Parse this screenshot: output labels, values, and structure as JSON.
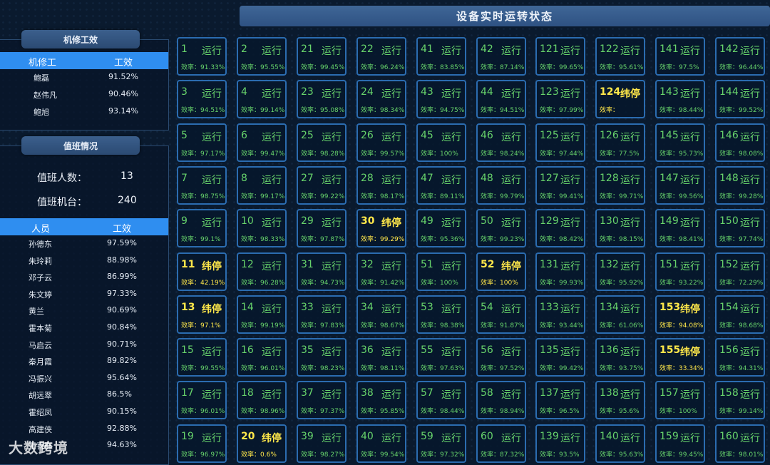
{
  "mechanic_panel": {
    "title": "机修工效",
    "headers": [
      "机修工",
      "工效"
    ],
    "rows": [
      {
        "name": "鲍磊",
        "eff": "91.52%"
      },
      {
        "name": "赵伟凡",
        "eff": "90.46%"
      },
      {
        "name": "鲍旭",
        "eff": "93.14%"
      }
    ]
  },
  "duty_panel": {
    "title": "值班情况",
    "count_label": "值班人数：",
    "count_value": "13",
    "machines_label": "值班机台：",
    "machines_value": "240",
    "headers": [
      "人员",
      "工效"
    ],
    "rows": [
      {
        "name": "孙德东",
        "eff": "97.59%"
      },
      {
        "name": "朱玲莉",
        "eff": "88.98%"
      },
      {
        "name": "邓子云",
        "eff": "86.99%"
      },
      {
        "name": "朱文婷",
        "eff": "97.33%"
      },
      {
        "name": "黄兰",
        "eff": "90.69%"
      },
      {
        "name": "霍本菊",
        "eff": "90.84%"
      },
      {
        "name": "马启云",
        "eff": "90.71%"
      },
      {
        "name": "秦月霞",
        "eff": "89.82%"
      },
      {
        "name": "冯振兴",
        "eff": "95.64%"
      },
      {
        "name": "胡远翠",
        "eff": "86.5%"
      },
      {
        "name": "霍绍凤",
        "eff": "90.15%"
      },
      {
        "name": "高建侠",
        "eff": "92.88%"
      },
      {
        "name": "王喜群",
        "eff": "94.63%"
      }
    ]
  },
  "status_panel": {
    "title": "设备实时运转状态",
    "running_label": "运行",
    "stopped_label": "纬停",
    "eff_prefix": "效率：",
    "columns": [
      [
        {
          "id": "1",
          "status": "运行",
          "eff": "91.33%"
        },
        {
          "id": "3",
          "status": "运行",
          "eff": "94.51%"
        },
        {
          "id": "5",
          "status": "运行",
          "eff": "97.17%"
        },
        {
          "id": "7",
          "status": "运行",
          "eff": "98.75%"
        },
        {
          "id": "9",
          "status": "运行",
          "eff": "99.1%"
        },
        {
          "id": "11",
          "status": "纬停",
          "eff": "42.19%"
        },
        {
          "id": "13",
          "status": "纬停",
          "eff": "97.1%"
        },
        {
          "id": "15",
          "status": "运行",
          "eff": "99.55%"
        },
        {
          "id": "17",
          "status": "运行",
          "eff": "96.01%"
        },
        {
          "id": "19",
          "status": "运行",
          "eff": "96.97%"
        }
      ],
      [
        {
          "id": "2",
          "status": "运行",
          "eff": "95.55%"
        },
        {
          "id": "4",
          "status": "运行",
          "eff": "99.14%"
        },
        {
          "id": "6",
          "status": "运行",
          "eff": "99.47%"
        },
        {
          "id": "8",
          "status": "运行",
          "eff": "99.17%"
        },
        {
          "id": "10",
          "status": "运行",
          "eff": "98.33%"
        },
        {
          "id": "12",
          "status": "运行",
          "eff": "96.28%"
        },
        {
          "id": "14",
          "status": "运行",
          "eff": "99.19%"
        },
        {
          "id": "16",
          "status": "运行",
          "eff": "96.01%"
        },
        {
          "id": "18",
          "status": "运行",
          "eff": "98.96%"
        },
        {
          "id": "20",
          "status": "纬停",
          "eff": "0.6%"
        }
      ],
      [
        {
          "id": "21",
          "status": "运行",
          "eff": "99.45%"
        },
        {
          "id": "23",
          "status": "运行",
          "eff": "95.08%"
        },
        {
          "id": "25",
          "status": "运行",
          "eff": "98.28%"
        },
        {
          "id": "27",
          "status": "运行",
          "eff": "99.22%"
        },
        {
          "id": "29",
          "status": "运行",
          "eff": "97.87%"
        },
        {
          "id": "31",
          "status": "运行",
          "eff": "94.73%"
        },
        {
          "id": "33",
          "status": "运行",
          "eff": "97.83%"
        },
        {
          "id": "35",
          "status": "运行",
          "eff": "98.23%"
        },
        {
          "id": "37",
          "status": "运行",
          "eff": "97.37%"
        },
        {
          "id": "39",
          "status": "运行",
          "eff": "98.27%"
        }
      ],
      [
        {
          "id": "22",
          "status": "运行",
          "eff": "96.24%"
        },
        {
          "id": "24",
          "status": "运行",
          "eff": "98.34%"
        },
        {
          "id": "26",
          "status": "运行",
          "eff": "99.57%"
        },
        {
          "id": "28",
          "status": "运行",
          "eff": "98.17%"
        },
        {
          "id": "30",
          "status": "纬停",
          "eff": "99.29%"
        },
        {
          "id": "32",
          "status": "运行",
          "eff": "91.42%"
        },
        {
          "id": "34",
          "status": "运行",
          "eff": "98.67%"
        },
        {
          "id": "36",
          "status": "运行",
          "eff": "98.11%"
        },
        {
          "id": "38",
          "status": "运行",
          "eff": "95.85%"
        },
        {
          "id": "40",
          "status": "运行",
          "eff": "99.54%"
        }
      ],
      [
        {
          "id": "41",
          "status": "运行",
          "eff": "83.85%"
        },
        {
          "id": "43",
          "status": "运行",
          "eff": "94.75%"
        },
        {
          "id": "45",
          "status": "运行",
          "eff": "100%"
        },
        {
          "id": "47",
          "status": "运行",
          "eff": "89.11%"
        },
        {
          "id": "49",
          "status": "运行",
          "eff": "95.36%"
        },
        {
          "id": "51",
          "status": "运行",
          "eff": "100%"
        },
        {
          "id": "53",
          "status": "运行",
          "eff": "98.38%"
        },
        {
          "id": "55",
          "status": "运行",
          "eff": "97.63%"
        },
        {
          "id": "57",
          "status": "运行",
          "eff": "98.44%"
        },
        {
          "id": "59",
          "status": "运行",
          "eff": "97.32%"
        }
      ],
      [
        {
          "id": "42",
          "status": "运行",
          "eff": "87.14%"
        },
        {
          "id": "44",
          "status": "运行",
          "eff": "94.51%"
        },
        {
          "id": "46",
          "status": "运行",
          "eff": "98.24%"
        },
        {
          "id": "48",
          "status": "运行",
          "eff": "99.79%"
        },
        {
          "id": "50",
          "status": "运行",
          "eff": "99.23%"
        },
        {
          "id": "52",
          "status": "纬停",
          "eff": "100%"
        },
        {
          "id": "54",
          "status": "运行",
          "eff": "91.87%"
        },
        {
          "id": "56",
          "status": "运行",
          "eff": "97.52%"
        },
        {
          "id": "58",
          "status": "运行",
          "eff": "98.94%"
        },
        {
          "id": "60",
          "status": "运行",
          "eff": "87.32%"
        }
      ],
      [
        {
          "id": "121",
          "status": "运行",
          "eff": "99.65%"
        },
        {
          "id": "123",
          "status": "运行",
          "eff": "97.99%"
        },
        {
          "id": "125",
          "status": "运行",
          "eff": "97.44%"
        },
        {
          "id": "127",
          "status": "运行",
          "eff": "99.41%"
        },
        {
          "id": "129",
          "status": "运行",
          "eff": "98.42%"
        },
        {
          "id": "131",
          "status": "运行",
          "eff": "99.93%"
        },
        {
          "id": "133",
          "status": "运行",
          "eff": "93.44%"
        },
        {
          "id": "135",
          "status": "运行",
          "eff": "99.42%"
        },
        {
          "id": "137",
          "status": "运行",
          "eff": "96.5%"
        },
        {
          "id": "139",
          "status": "运行",
          "eff": "93.5%"
        }
      ],
      [
        {
          "id": "122",
          "status": "运行",
          "eff": "95.61%"
        },
        {
          "id": "124",
          "status": "纬停",
          "eff": ""
        },
        {
          "id": "126",
          "status": "运行",
          "eff": "77.5%"
        },
        {
          "id": "128",
          "status": "运行",
          "eff": "99.71%"
        },
        {
          "id": "130",
          "status": "运行",
          "eff": "98.15%"
        },
        {
          "id": "132",
          "status": "运行",
          "eff": "95.92%"
        },
        {
          "id": "134",
          "status": "运行",
          "eff": "61.06%"
        },
        {
          "id": "136",
          "status": "运行",
          "eff": "93.75%"
        },
        {
          "id": "138",
          "status": "运行",
          "eff": "95.6%"
        },
        {
          "id": "140",
          "status": "运行",
          "eff": "95.63%"
        }
      ],
      [
        {
          "id": "141",
          "status": "运行",
          "eff": "97.5%"
        },
        {
          "id": "143",
          "status": "运行",
          "eff": "98.44%"
        },
        {
          "id": "145",
          "status": "运行",
          "eff": "95.73%"
        },
        {
          "id": "147",
          "status": "运行",
          "eff": "99.56%"
        },
        {
          "id": "149",
          "status": "运行",
          "eff": "98.41%"
        },
        {
          "id": "151",
          "status": "运行",
          "eff": "93.22%"
        },
        {
          "id": "153",
          "status": "纬停",
          "eff": "94.08%"
        },
        {
          "id": "155",
          "status": "纬停",
          "eff": "33.34%"
        },
        {
          "id": "157",
          "status": "运行",
          "eff": "100%"
        },
        {
          "id": "159",
          "status": "运行",
          "eff": "99.45%"
        }
      ],
      [
        {
          "id": "142",
          "status": "运行",
          "eff": "96.44%"
        },
        {
          "id": "144",
          "status": "运行",
          "eff": "99.52%"
        },
        {
          "id": "146",
          "status": "运行",
          "eff": "98.08%"
        },
        {
          "id": "148",
          "status": "运行",
          "eff": "99.28%"
        },
        {
          "id": "150",
          "status": "运行",
          "eff": "97.74%"
        },
        {
          "id": "152",
          "status": "运行",
          "eff": "72.29%"
        },
        {
          "id": "154",
          "status": "运行",
          "eff": "98.68%"
        },
        {
          "id": "156",
          "status": "运行",
          "eff": "94.31%"
        },
        {
          "id": "158",
          "status": "运行",
          "eff": "99.14%"
        },
        {
          "id": "160",
          "status": "运行",
          "eff": "98.01%"
        }
      ]
    ]
  },
  "watermark": "大数跨境"
}
